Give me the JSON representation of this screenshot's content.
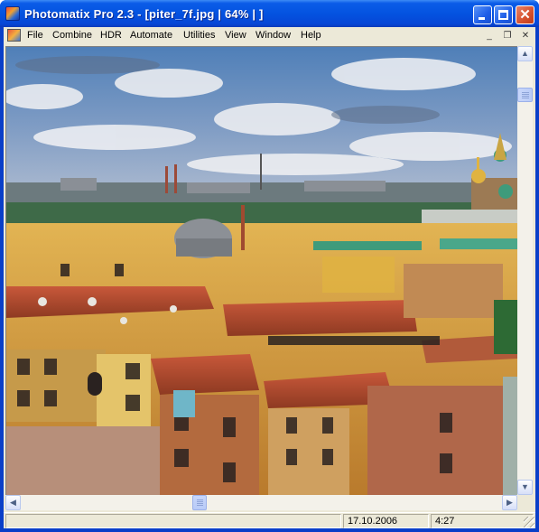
{
  "window": {
    "title": "Photomatix Pro 2.3 - [piter_7f.jpg | 64% | ]",
    "controls": {
      "minimize": "minimize",
      "maximize": "maximize",
      "close": "✕"
    }
  },
  "menu": {
    "items": [
      "File",
      "Combine",
      "HDR",
      "Automate",
      "Utilities",
      "View",
      "Window",
      "Help"
    ],
    "mdi_controls": {
      "minimize": "_",
      "restore": "❐",
      "close": "✕"
    }
  },
  "image": {
    "subject": "HDR rooftop panorama",
    "colors": {
      "sky_top": "#4f7fb8",
      "sky_low": "#9fb3cf",
      "roofs_red": "#b84a2e",
      "walls_ochre": "#d9a845",
      "gold_dome": "#e0b341",
      "green_roof": "#3f9b7b"
    }
  },
  "scrollbars": {
    "vertical_position": 0.08,
    "horizontal_position": 0.38
  },
  "status": {
    "message": "",
    "date": "17.10.2006",
    "time": "4:27"
  },
  "accent": {
    "titlebar": "#0453e0",
    "close": "#d6502c"
  }
}
